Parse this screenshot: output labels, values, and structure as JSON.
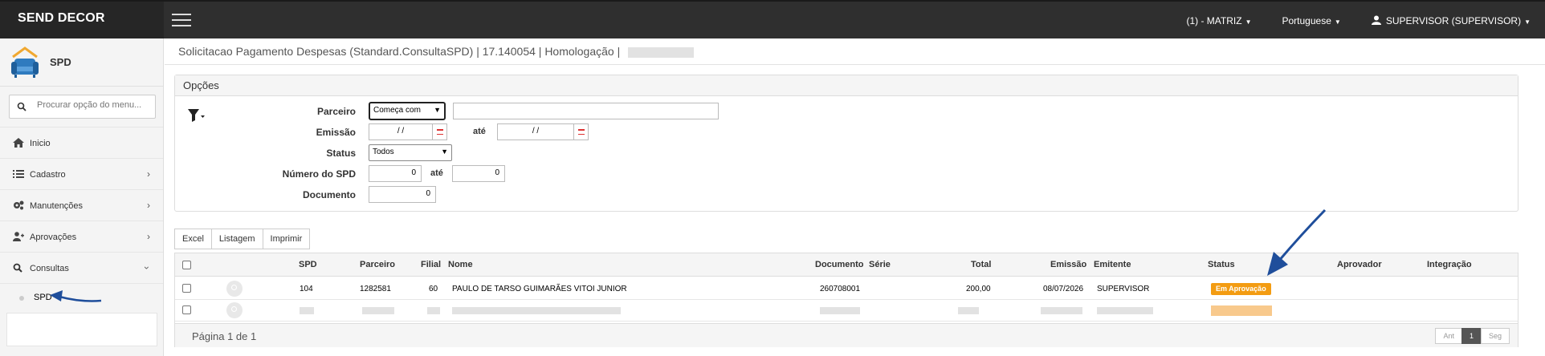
{
  "brand": "SEND DECOR",
  "topbar": {
    "company": "(1) - MATRIZ",
    "language": "Portuguese",
    "user": "SUPERVISOR (SUPERVISOR)"
  },
  "sidebar": {
    "module_title": "SPD",
    "search_placeholder": "Procurar opção do menu...",
    "items": [
      {
        "label": "Inicio",
        "icon": "home-icon"
      },
      {
        "label": "Cadastro",
        "icon": "list-icon"
      },
      {
        "label": "Manutenções",
        "icon": "gears-icon"
      },
      {
        "label": "Aprovações",
        "icon": "user-plus-icon"
      },
      {
        "label": "Consultas",
        "icon": "search-icon"
      }
    ],
    "sub_items": [
      {
        "label": "SPD"
      }
    ]
  },
  "page": {
    "title": "Solicitacao Pagamento Despesas (Standard.ConsultaSPD) | 17.140054 | Homologação |"
  },
  "options": {
    "title": "Opções",
    "labels": {
      "parceiro": "Parceiro",
      "emissao": "Emissão",
      "status": "Status",
      "numero_spd": "Número do SPD",
      "documento": "Documento"
    },
    "parceiro_mode": "Começa com",
    "parceiro_value": "",
    "emissao_from": "/ /",
    "emissao_to": "/ /",
    "ate": "até",
    "status_value": "Todos",
    "spd_from": "0",
    "spd_to": "0",
    "documento": "0"
  },
  "actions": {
    "excel": "Excel",
    "listagem": "Listagem",
    "imprimir": "Imprimir"
  },
  "table": {
    "columns": [
      "SPD",
      "Parceiro",
      "Filial",
      "Nome",
      "Documento",
      "Série",
      "Total",
      "Emissão",
      "Emitente",
      "Status",
      "Aprovador",
      "Integração"
    ],
    "rows": [
      {
        "spd": "104",
        "parceiro": "1282581",
        "filial": "60",
        "nome": "PAULO DE TARSO GUIMARÃES VITOI JUNIOR",
        "documento": "260708001",
        "serie": "",
        "total": "200,00",
        "emissao": "08/07/2026",
        "emitente": "SUPERVISOR",
        "status": "Em Aprovação",
        "aprovador": "",
        "integracao": ""
      }
    ]
  },
  "pagination": {
    "info": "Página 1 de 1",
    "prev": "Ant",
    "current": "1",
    "next": "Seg"
  },
  "colors": {
    "topbar": "#2f2f2f",
    "status_badge": "#f39c12",
    "annotation_arrow": "#1f4e9b"
  }
}
